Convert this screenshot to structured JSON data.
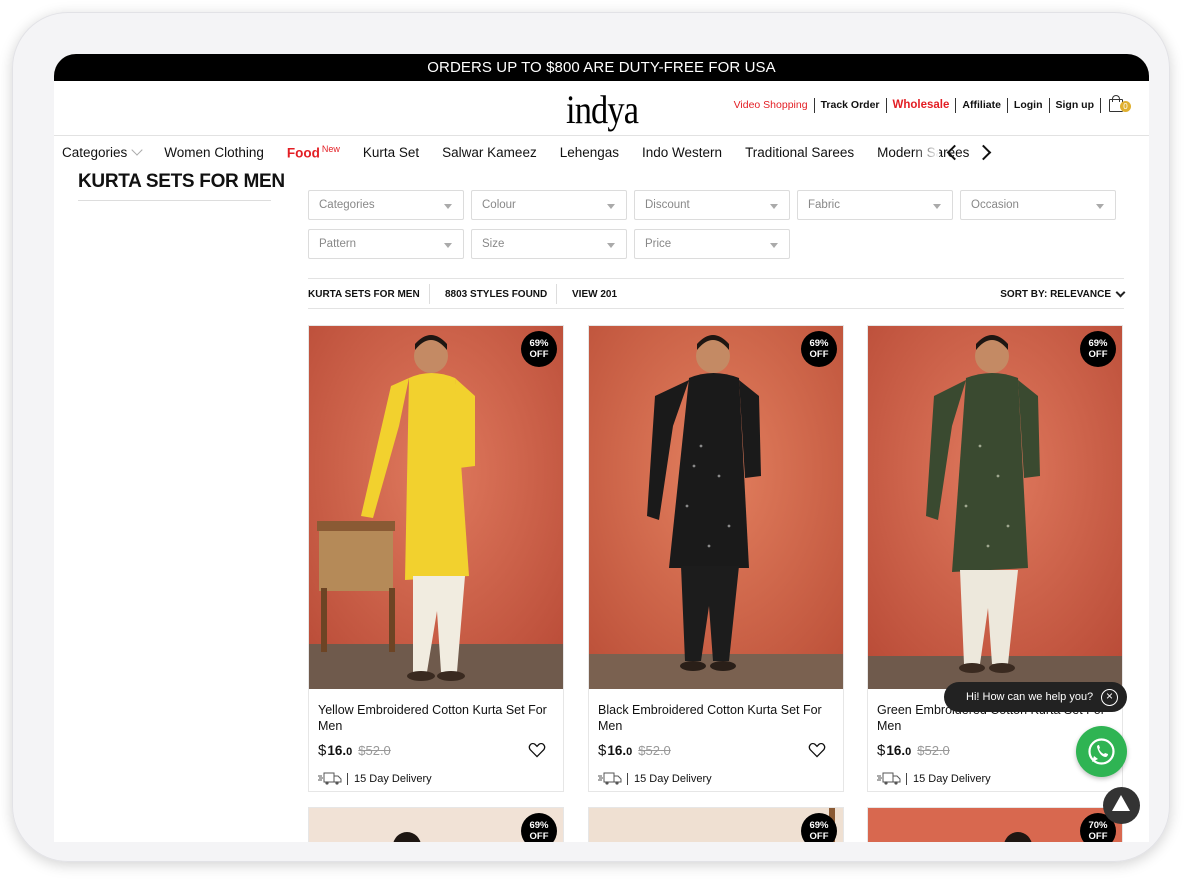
{
  "promo": {
    "text": "ORDERS UP TO $800 ARE DUTY-FREE FOR USA"
  },
  "header": {
    "logo": "indya",
    "links": {
      "video_shopping": "Video Shopping",
      "track_order": "Track Order",
      "wholesale": "Wholesale",
      "affiliate": "Affiliate",
      "login": "Login",
      "signup": "Sign up"
    },
    "cart_count": "0",
    "cart_icon": "shopping-bag-icon"
  },
  "nav": {
    "items": [
      "Categories",
      "Women Clothing",
      "Food",
      "Kurta Set",
      "Salwar Kameez",
      "Lehengas",
      "Indo Western",
      "Traditional Sarees",
      "Modern Sarees"
    ],
    "food_badge": "New"
  },
  "page": {
    "title": "KURTA SETS FOR MEN"
  },
  "filters": [
    "Categories",
    "Colour",
    "Discount",
    "Fabric",
    "Occasion",
    "Pattern",
    "Size",
    "Price"
  ],
  "results": {
    "category": "KURTA SETS FOR MEN",
    "found": "8803 STYLES FOUND",
    "view": "VIEW 201",
    "sort": "SORT BY: RELEVANCE"
  },
  "products": [
    {
      "name": "Yellow Embroidered Cotton Kurta Set For Men",
      "badge_pct": "69%",
      "badge_off": "OFF",
      "currency": "$",
      "price_int": "16.",
      "price_dec": "0",
      "old_price": "$52.0",
      "delivery": "15 Day Delivery",
      "kurta_color": "#f2d12e",
      "pants_color": "#f1ece0"
    },
    {
      "name": "Black Embroidered Cotton Kurta Set For Men",
      "badge_pct": "69%",
      "badge_off": "OFF",
      "currency": "$",
      "price_int": "16.",
      "price_dec": "0",
      "old_price": "$52.0",
      "delivery": "15 Day Delivery",
      "kurta_color": "#1a1a1a",
      "pants_color": "#1c1c1c"
    },
    {
      "name": "Green Embroidered Cotton Kurta Set For Men",
      "badge_pct": "69%",
      "badge_off": "OFF",
      "currency": "$",
      "price_int": "16.",
      "price_dec": "0",
      "old_price": "$52.0",
      "delivery": "15 Day Delivery",
      "kurta_color": "#3a4a30",
      "pants_color": "#ede8dc"
    }
  ],
  "next_row_badges": [
    {
      "pct": "69%",
      "off": "OFF"
    },
    {
      "pct": "69%",
      "off": "OFF"
    },
    {
      "pct": "70%",
      "off": "OFF"
    }
  ],
  "chat": {
    "text": "Hi! How can we help you?",
    "close": "×"
  },
  "colors": {
    "accent_red": "#e31e24",
    "whatsapp_green": "#2fb453",
    "background_orange": "#d9674e"
  }
}
